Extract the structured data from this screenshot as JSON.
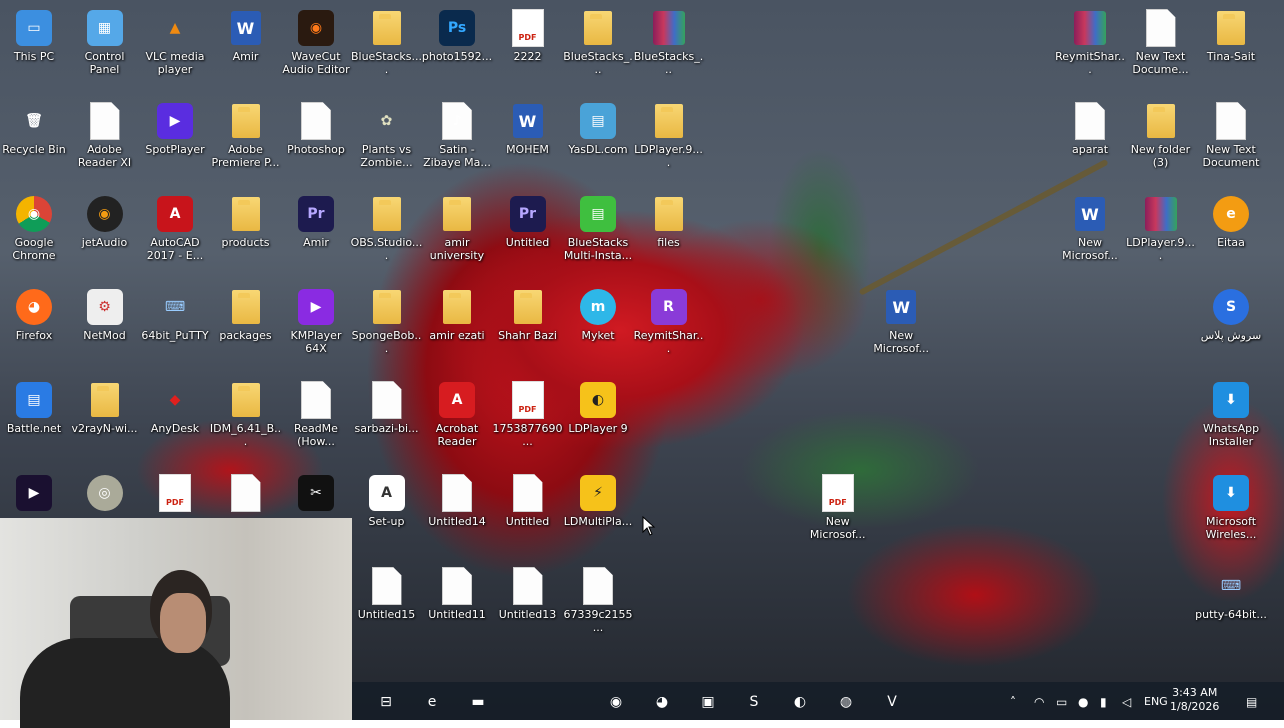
{
  "desktop": {
    "icons": [
      {
        "label": "This PC",
        "col": 0,
        "row": 0,
        "kind": "pc"
      },
      {
        "label": "Control Panel",
        "col": 1,
        "row": 0,
        "kind": "cpanel"
      },
      {
        "label": "VLC media player",
        "col": 2,
        "row": 0,
        "kind": "vlc"
      },
      {
        "label": "Amir",
        "col": 3,
        "row": 0,
        "kind": "word"
      },
      {
        "label": "WaveCut Audio Editor",
        "col": 4,
        "row": 0,
        "kind": "wavecut"
      },
      {
        "label": "BlueStacks....",
        "col": 5,
        "row": 0,
        "kind": "folder"
      },
      {
        "label": "photo1592...",
        "col": 6,
        "row": 0,
        "kind": "psd"
      },
      {
        "label": "2222",
        "col": 7,
        "row": 0,
        "kind": "pdf"
      },
      {
        "label": "BlueStacks_...",
        "col": 8,
        "row": 0,
        "kind": "folder"
      },
      {
        "label": "BlueStacks_...",
        "col": 9,
        "row": 0,
        "kind": "rar"
      },
      {
        "label": "Recycle Bin",
        "col": 0,
        "row": 1,
        "kind": "bin"
      },
      {
        "label": "Adobe Reader XI",
        "col": 1,
        "row": 1,
        "kind": "doc"
      },
      {
        "label": "SpotPlayer",
        "col": 2,
        "row": 1,
        "kind": "spot"
      },
      {
        "label": "Adobe Premiere P...",
        "col": 3,
        "row": 1,
        "kind": "folder"
      },
      {
        "label": "Photoshop",
        "col": 4,
        "row": 1,
        "kind": "doc"
      },
      {
        "label": "Plants vs Zombie...",
        "col": 5,
        "row": 1,
        "kind": "plants"
      },
      {
        "label": "Satin - Zibaye Ma...",
        "col": 6,
        "row": 1,
        "kind": "mp3"
      },
      {
        "label": "MOHEM",
        "col": 7,
        "row": 1,
        "kind": "word"
      },
      {
        "label": "YasDL.com",
        "col": 8,
        "row": 1,
        "kind": "yasdl"
      },
      {
        "label": "LDPlayer.9....",
        "col": 9,
        "row": 1,
        "kind": "folder"
      },
      {
        "label": "Google Chrome",
        "col": 0,
        "row": 2,
        "kind": "chrome"
      },
      {
        "label": "jetAudio",
        "col": 1,
        "row": 2,
        "kind": "jetaudio"
      },
      {
        "label": "AutoCAD 2017 - E...",
        "col": 2,
        "row": 2,
        "kind": "autocad"
      },
      {
        "label": "products",
        "col": 3,
        "row": 2,
        "kind": "folder"
      },
      {
        "label": "Amir",
        "col": 4,
        "row": 2,
        "kind": "premiere"
      },
      {
        "label": "OBS.Studio....",
        "col": 5,
        "row": 2,
        "kind": "folder"
      },
      {
        "label": "amir university",
        "col": 6,
        "row": 2,
        "kind": "folder"
      },
      {
        "label": "Untitled",
        "col": 7,
        "row": 2,
        "kind": "premiere"
      },
      {
        "label": "BlueStacks Multi-Insta...",
        "col": 8,
        "row": 2,
        "kind": "bluestacks"
      },
      {
        "label": "files",
        "col": 9,
        "row": 2,
        "kind": "folder"
      },
      {
        "label": "Firefox",
        "col": 0,
        "row": 3,
        "kind": "firefox"
      },
      {
        "label": "NetMod",
        "col": 1,
        "row": 3,
        "kind": "netmod"
      },
      {
        "label": "64bit_PuTTY",
        "col": 2,
        "row": 3,
        "kind": "putty"
      },
      {
        "label": "packages",
        "col": 3,
        "row": 3,
        "kind": "folder"
      },
      {
        "label": "KMPlayer 64X",
        "col": 4,
        "row": 3,
        "kind": "kmplayer"
      },
      {
        "label": "SpongeBob...",
        "col": 5,
        "row": 3,
        "kind": "folder"
      },
      {
        "label": "amir ezati",
        "col": 6,
        "row": 3,
        "kind": "folder"
      },
      {
        "label": "Shahr Bazi",
        "col": 7,
        "row": 3,
        "kind": "folder"
      },
      {
        "label": "Myket",
        "col": 8,
        "row": 3,
        "kind": "myket"
      },
      {
        "label": "ReymitShar...",
        "col": 9,
        "row": 3,
        "kind": "reymit"
      },
      {
        "label": "Battle.net",
        "col": 0,
        "row": 4,
        "kind": "battlenet"
      },
      {
        "label": "v2rayN-wi...",
        "col": 1,
        "row": 4,
        "kind": "folder"
      },
      {
        "label": "AnyDesk",
        "col": 2,
        "row": 4,
        "kind": "anydesk"
      },
      {
        "label": "IDM_6.41_B...",
        "col": 3,
        "row": 4,
        "kind": "folder"
      },
      {
        "label": "ReadMe (How...",
        "col": 4,
        "row": 4,
        "kind": "txt"
      },
      {
        "label": "sarbazi-bi...",
        "col": 5,
        "row": 4,
        "kind": "doc"
      },
      {
        "label": "Acrobat Reader",
        "col": 6,
        "row": 4,
        "kind": "acrobat"
      },
      {
        "label": "1753877690...",
        "col": 7,
        "row": 4,
        "kind": "pdf"
      },
      {
        "label": "LDPlayer 9",
        "col": 8,
        "row": 4,
        "kind": "ldplayer"
      },
      {
        "label": "",
        "col": 0,
        "row": 5,
        "kind": "media"
      },
      {
        "label": "",
        "col": 1,
        "row": 5,
        "kind": "dvd"
      },
      {
        "label": "",
        "col": 2,
        "row": 5,
        "kind": "pdf"
      },
      {
        "label": "",
        "col": 3,
        "row": 5,
        "kind": "doc"
      },
      {
        "label": "",
        "col": 4,
        "row": 5,
        "kind": "capcut"
      },
      {
        "label": "Set-up",
        "col": 5,
        "row": 5,
        "kind": "setup"
      },
      {
        "label": "Untitled14",
        "col": 6,
        "row": 5,
        "kind": "doc"
      },
      {
        "label": "Untitled",
        "col": 7,
        "row": 5,
        "kind": "doc"
      },
      {
        "label": "LDMultiPla...",
        "col": 8,
        "row": 5,
        "kind": "ldmulti"
      },
      {
        "label": "Untitled15",
        "col": 5,
        "row": 6,
        "kind": "doc"
      },
      {
        "label": "Untitled11",
        "col": 6,
        "row": 6,
        "kind": "doc"
      },
      {
        "label": "Untitled13",
        "col": 7,
        "row": 6,
        "kind": "doc"
      },
      {
        "label": "67339c2155...",
        "col": 8,
        "row": 6,
        "kind": "doc"
      },
      {
        "label": "New Microsof...",
        "col": 12.3,
        "row": 3,
        "kind": "word"
      },
      {
        "label": "New Microsof...",
        "col": 11.4,
        "row": 5,
        "kind": "pdf"
      },
      {
        "label": "ReymitShar...",
        "col": 15,
        "row": 0,
        "kind": "rar"
      },
      {
        "label": "New Text Docume...",
        "col": 16,
        "row": 0,
        "kind": "doc"
      },
      {
        "label": "Tina-Sait",
        "col": 17,
        "row": 0,
        "kind": "folder"
      },
      {
        "label": "aparat",
        "col": 15,
        "row": 1,
        "kind": "doc"
      },
      {
        "label": "New folder (3)",
        "col": 16,
        "row": 1,
        "kind": "folder"
      },
      {
        "label": "New Text Document",
        "col": 17,
        "row": 1,
        "kind": "txt"
      },
      {
        "label": "New Microsof...",
        "col": 15,
        "row": 2,
        "kind": "word"
      },
      {
        "label": "LDPlayer.9....",
        "col": 16,
        "row": 2,
        "kind": "rar"
      },
      {
        "label": "Eitaa",
        "col": 17,
        "row": 2,
        "kind": "eitaa"
      },
      {
        "label": "سروش پلاس",
        "col": 17,
        "row": 3,
        "kind": "soroush"
      },
      {
        "label": "WhatsApp Installer",
        "col": 17,
        "row": 4,
        "kind": "installer"
      },
      {
        "label": "Microsoft Wireles...",
        "col": 17,
        "row": 5,
        "kind": "installer"
      },
      {
        "label": "putty-64bit...",
        "col": 17,
        "row": 6,
        "kind": "putty"
      }
    ]
  },
  "taskbar": {
    "apps": [
      {
        "name": "task-view",
        "glyph": "⊟"
      },
      {
        "name": "edge",
        "glyph": "e"
      },
      {
        "name": "file-explorer",
        "glyph": "▬"
      },
      {
        "name": "chrome",
        "glyph": "◉"
      },
      {
        "name": "firefox",
        "glyph": "◕"
      },
      {
        "name": "desktop-tool",
        "glyph": "▣"
      },
      {
        "name": "soroush",
        "glyph": "S"
      },
      {
        "name": "ldplayer",
        "glyph": "◐"
      },
      {
        "name": "obs",
        "glyph": "◍"
      },
      {
        "name": "vivaldi",
        "glyph": "V"
      }
    ],
    "tray": {
      "language": "ENG",
      "time": "3:43 AM",
      "date": "1/8/2026"
    }
  },
  "colors": {
    "taskbar_bg": "#161e28",
    "folder": "#f0c350",
    "accent_red": "#d01a22"
  }
}
